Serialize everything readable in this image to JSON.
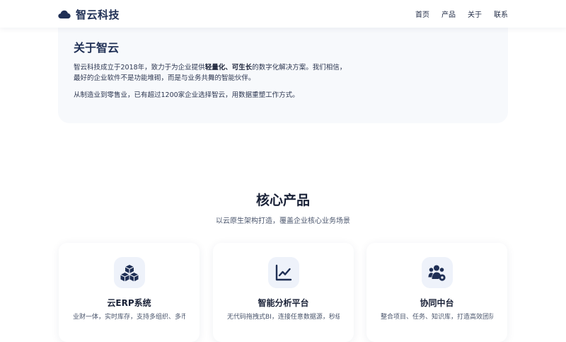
{
  "header": {
    "logo_text": "智云科技",
    "nav": [
      "首页",
      "产品",
      "关于",
      "联系"
    ]
  },
  "about": {
    "title": "关于智云",
    "p1_a": "智云科技成立于2018年，致力于为企业提供",
    "p1_bold": "轻量化、可生长",
    "p1_b": "的数字化解决方案。我们相信，",
    "p1_c": "最好的企业软件不是功能堆砌，而是与业务共舞的智能伙伴。",
    "p2": "从制造业到零售业，已有超过1200家企业选择智云，用数据重塑工作方式。"
  },
  "products": {
    "title": "核心产品",
    "subtitle": "以云原生架构打造，覆盖企业核心业务场景",
    "cards": [
      {
        "icon": "cubes-icon",
        "title": "云ERP系统",
        "desc": "业财一体，实时库存，支持多组织、多币"
      },
      {
        "icon": "chart-line-icon",
        "title": "智能分析平台",
        "desc": "无代码拖拽式BI，连接任意数据源，秒级洞"
      },
      {
        "icon": "users-gear-icon",
        "title": "协同中台",
        "desc": "整合项目、任务、知识库，打造高效团队协"
      }
    ]
  },
  "colors": {
    "brand": "#1f2f55",
    "card_bg": "#f7f9fc",
    "icon_bg": "#eef2fa"
  }
}
